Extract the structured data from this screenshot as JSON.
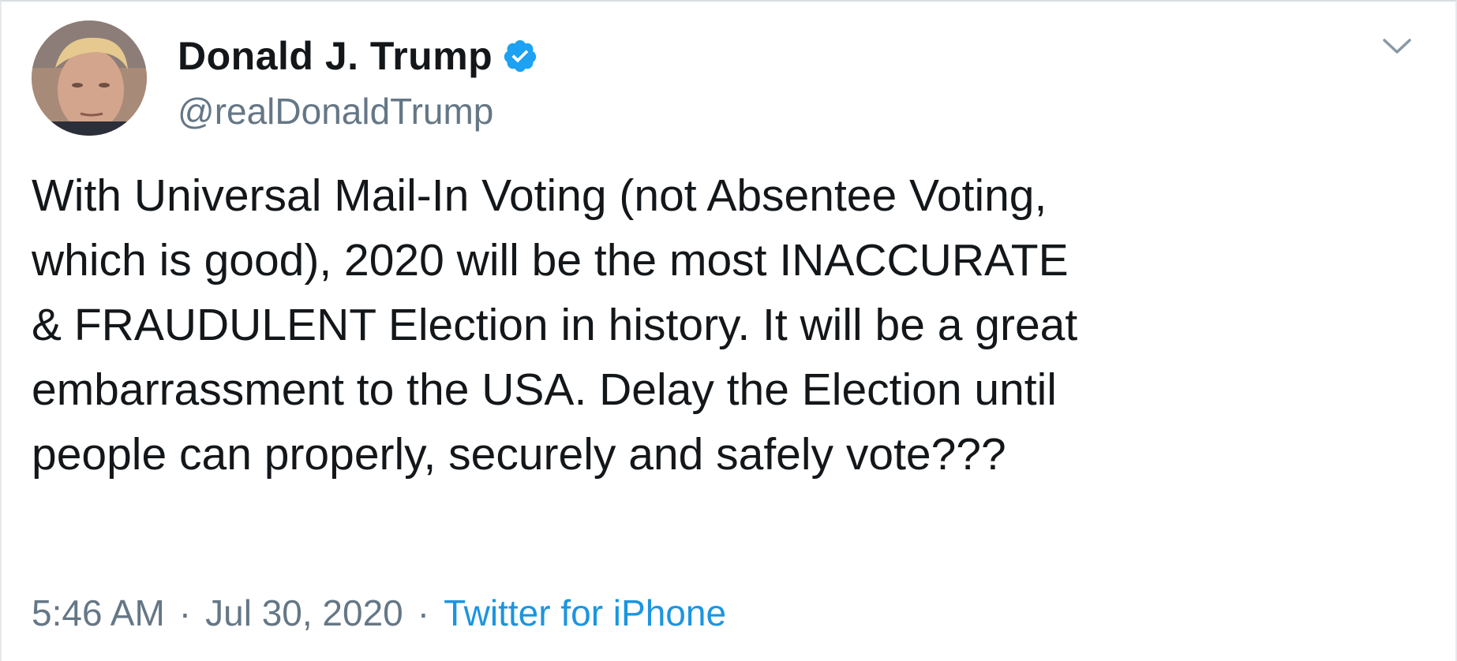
{
  "tweet": {
    "author": {
      "display_name": "Donald J. Trump",
      "handle": "@realDonaldTrump",
      "verified": true,
      "avatar": "profile-photo"
    },
    "text": "With Universal Mail-In Voting (not Absentee Voting,\nwhich is good), 2020 will be the most INACCURATE\n& FRAUDULENT Election in history. It will be a great\nembarrassment to the USA. Delay the Election until\npeople can properly, securely and safely vote???",
    "time": "5:46 AM",
    "separator": "·",
    "date": "Jul 30, 2020",
    "source": "Twitter for iPhone"
  },
  "icons": {
    "verified": "verified-badge-icon",
    "menu": "chevron-down-icon"
  },
  "colors": {
    "text": "#14171a",
    "secondary": "#657786",
    "link": "#1b95e0",
    "verified": "#1da1f2"
  }
}
